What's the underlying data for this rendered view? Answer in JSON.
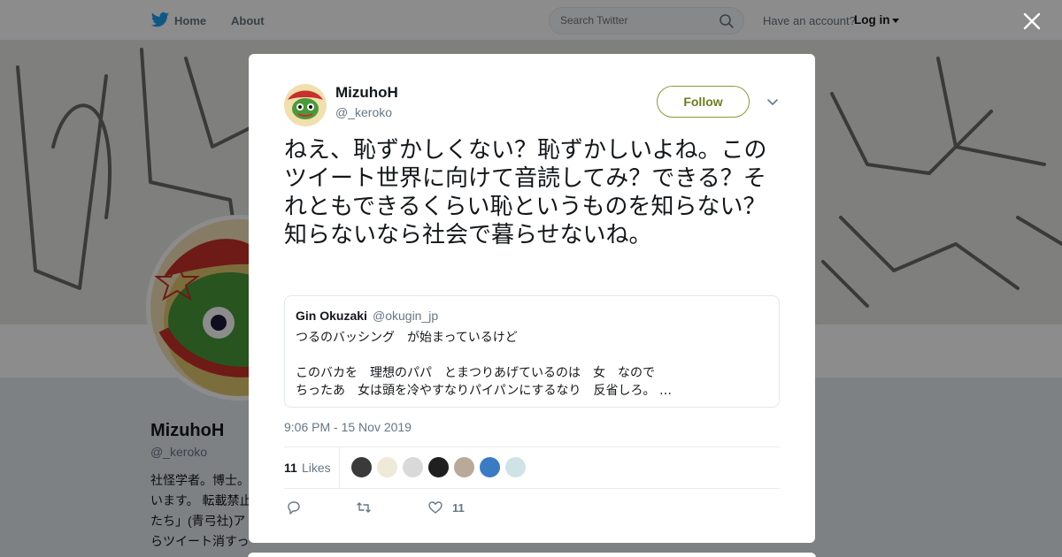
{
  "nav": {
    "home": "Home",
    "about": "About",
    "search_placeholder": "Search Twitter",
    "have_account": "Have an account?",
    "login": "Log in"
  },
  "profile": {
    "name": "MizuhoH",
    "handle": "@_keroko",
    "bio": [
      "社怪学者。博士。",
      "います。 転載禁止",
      "たち」(青弓社)ア",
      "らツイート消すっ"
    ]
  },
  "tweet": {
    "name": "MizuhoH",
    "handle": "@_keroko",
    "follow_label": "Follow",
    "text": "ねえ、恥ずかしくない？恥ずかしいよね。このツイート世界に向けて音読してみ？できる？それともできるくらい恥というものを知らない？知らないなら社会で暮らせないね。",
    "quote": {
      "name": "Gin Okuzaki",
      "handle": "@okugin_jp",
      "lines": [
        "つるのバッシング　が始まっているけど",
        "",
        "このバカを　理想のパパ　とまつりあげているのは　女　なので",
        "ちったあ　女は頭を冷やすなりパイパンにするなり　反省しろ。 …"
      ]
    },
    "timestamp": "9:06 PM - 15 Nov 2019",
    "likes_count": "11",
    "likes_label": "Likes",
    "like_action_count": "11"
  },
  "colors": {
    "accent": "#1da1f2",
    "follow": "#6b7d1e",
    "muted": "#657786"
  },
  "icons": [
    "twitter-bird-icon",
    "search-icon",
    "close-icon",
    "chevron-down-icon",
    "reply-icon",
    "retweet-icon",
    "heart-icon"
  ]
}
